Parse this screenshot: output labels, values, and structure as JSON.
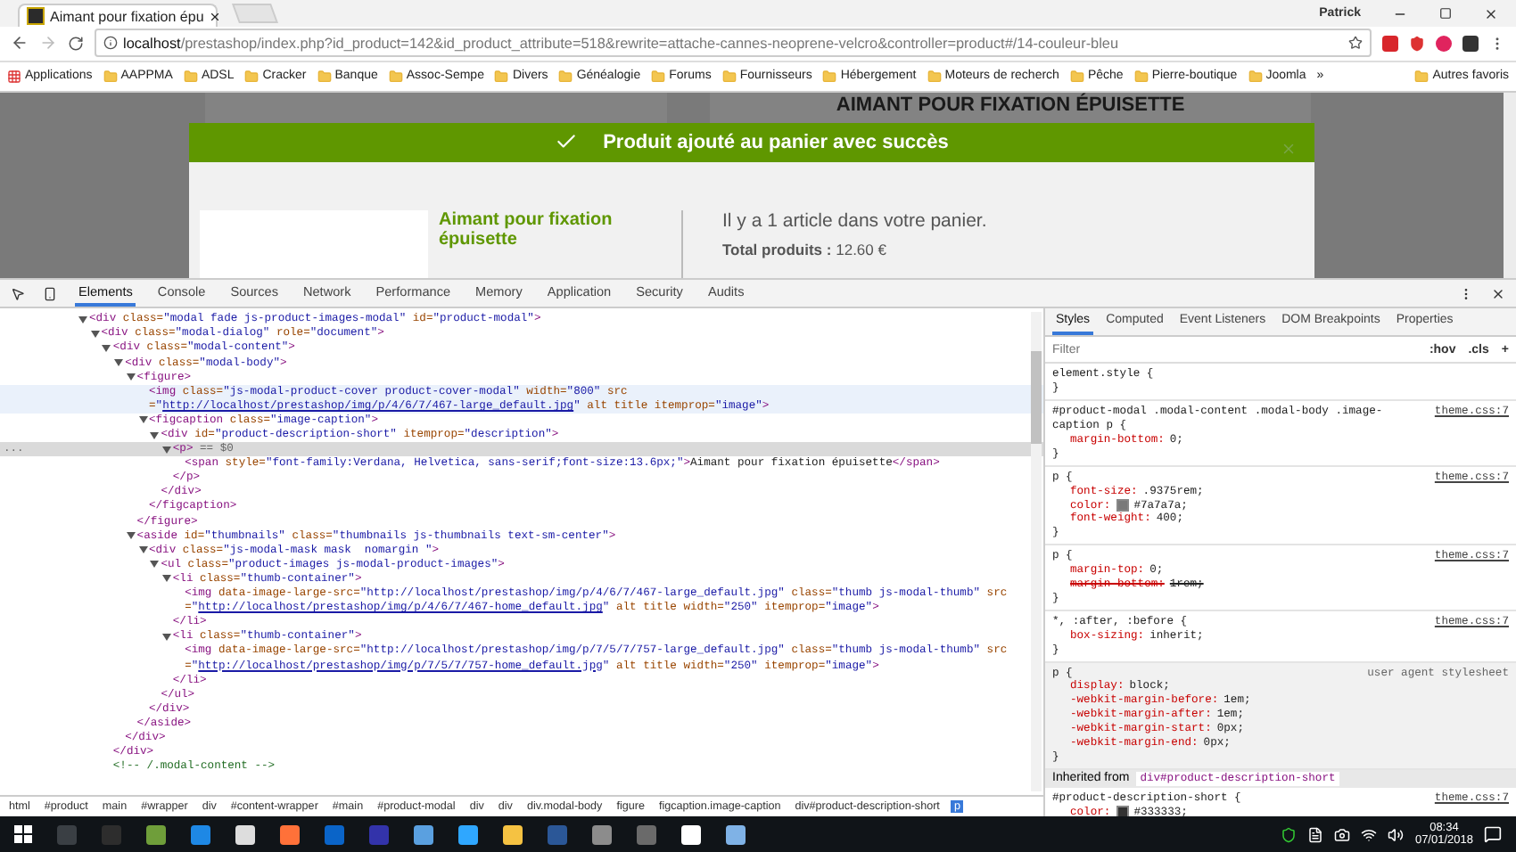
{
  "browser": {
    "tab_title": "Aimant pour fixation épu",
    "profile_name": "Patrick",
    "url_host": "localhost",
    "url_path": "/prestashop/index.php?id_product=142&id_product_attribute=518&rewrite=attache-cannes-neoprene-velcro&controller=product#/14-couleur-bleu",
    "bookmarks": [
      {
        "kind": "apps",
        "label": "Applications"
      },
      {
        "kind": "folder",
        "label": "AAPPMA"
      },
      {
        "kind": "folder",
        "label": "ADSL"
      },
      {
        "kind": "folder",
        "label": "Cracker"
      },
      {
        "kind": "folder",
        "label": "Banque"
      },
      {
        "kind": "folder",
        "label": "Assoc-Sempe"
      },
      {
        "kind": "folder",
        "label": "Divers"
      },
      {
        "kind": "folder",
        "label": "Généalogie"
      },
      {
        "kind": "folder",
        "label": "Forums"
      },
      {
        "kind": "folder",
        "label": "Fournisseurs"
      },
      {
        "kind": "folder",
        "label": "Hébergement"
      },
      {
        "kind": "folder",
        "label": "Moteurs de recherch"
      },
      {
        "kind": "folder",
        "label": "Pêche"
      },
      {
        "kind": "folder",
        "label": "Pierre-boutique"
      },
      {
        "kind": "folder",
        "label": "Joomla"
      },
      {
        "kind": "overflow",
        "label": "»"
      },
      {
        "kind": "folder",
        "label": "Autres favoris"
      }
    ]
  },
  "page": {
    "heading": "AIMANT POUR FIXATION ÉPUISETTE",
    "banner": "Produit ajouté au panier avec succès",
    "product_name": "Aimant pour fixation épuisette",
    "cart_message": "Il y a 1 article dans votre panier.",
    "total_label": "Total produits :",
    "total_value": "12.60 €"
  },
  "devtools": {
    "tabs": [
      {
        "label": "Elements",
        "selected": true
      },
      {
        "label": "Console",
        "selected": false
      },
      {
        "label": "Sources",
        "selected": false
      },
      {
        "label": "Network",
        "selected": false
      },
      {
        "label": "Performance",
        "selected": false
      },
      {
        "label": "Memory",
        "selected": false
      },
      {
        "label": "Application",
        "selected": false
      },
      {
        "label": "Security",
        "selected": false
      },
      {
        "label": "Audits",
        "selected": false
      }
    ],
    "dom_tree": [
      {
        "expanded": true,
        "selected": false,
        "hovered": false,
        "open": [
          {
            "kind": "tag",
            "text": "<div"
          },
          {
            "kind": "attr",
            "text": " class="
          },
          {
            "kind": "value",
            "text": "\"modal fade js-product-images-modal\""
          },
          {
            "kind": "attr",
            "text": " id="
          },
          {
            "kind": "value",
            "text": "\"product-modal\""
          },
          {
            "kind": "tag",
            "text": ">"
          }
        ],
        "children": [
          {
            "expanded": true,
            "selected": false,
            "hovered": false,
            "open": [
              {
                "kind": "tag",
                "text": "<div"
              },
              {
                "kind": "attr",
                "text": " class="
              },
              {
                "kind": "value",
                "text": "\"modal-dialog\""
              },
              {
                "kind": "attr",
                "text": " role="
              },
              {
                "kind": "value",
                "text": "\"document\""
              },
              {
                "kind": "tag",
                "text": ">"
              }
            ],
            "children": [
              {
                "expanded": true,
                "selected": false,
                "hovered": false,
                "open": [
                  {
                    "kind": "tag",
                    "text": "<div"
                  },
                  {
                    "kind": "attr",
                    "text": " class="
                  },
                  {
                    "kind": "value",
                    "text": "\"modal-content\""
                  },
                  {
                    "kind": "tag",
                    "text": ">"
                  }
                ],
                "children": [
                  {
                    "expanded": true,
                    "selected": false,
                    "hovered": false,
                    "open": [
                      {
                        "kind": "tag",
                        "text": "<div"
                      },
                      {
                        "kind": "attr",
                        "text": " class="
                      },
                      {
                        "kind": "value",
                        "text": "\"modal-body\""
                      },
                      {
                        "kind": "tag",
                        "text": ">"
                      }
                    ],
                    "children": [
                      {
                        "expanded": true,
                        "selected": false,
                        "hovered": false,
                        "open": [
                          {
                            "kind": "tag",
                            "text": "<figure>"
                          }
                        ],
                        "children": [
                          {
                            "selected": false,
                            "hovered": true,
                            "open": [
                              {
                                "kind": "tag",
                                "text": "<img"
                              },
                              {
                                "kind": "attr",
                                "text": " class="
                              },
                              {
                                "kind": "value",
                                "text": "\"js-modal-product-cover product-cover-modal\""
                              },
                              {
                                "kind": "attr",
                                "text": " width="
                              },
                              {
                                "kind": "value",
                                "text": "\"800\""
                              },
                              {
                                "kind": "attr",
                                "text": " src="
                              },
                              {
                                "kind": "value",
                                "text": "\""
                              },
                              {
                                "kind": "link",
                                "text": "http://localhost/prestashop/img/p/4/6/7/467-large_default.jpg"
                              },
                              {
                                "kind": "value",
                                "text": "\""
                              },
                              {
                                "kind": "attr",
                                "text": " alt title itemprop="
                              },
                              {
                                "kind": "value",
                                "text": "\"image\""
                              },
                              {
                                "kind": "tag",
                                "text": ">"
                              }
                            ]
                          },
                          {
                            "expanded": true,
                            "selected": false,
                            "hovered": false,
                            "open": [
                              {
                                "kind": "tag",
                                "text": "<figcaption"
                              },
                              {
                                "kind": "attr",
                                "text": " class="
                              },
                              {
                                "kind": "value",
                                "text": "\"image-caption\""
                              },
                              {
                                "kind": "tag",
                                "text": ">"
                              }
                            ],
                            "children": [
                              {
                                "expanded": true,
                                "selected": false,
                                "hovered": false,
                                "open": [
                                  {
                                    "kind": "tag",
                                    "text": "<div"
                                  },
                                  {
                                    "kind": "attr",
                                    "text": " id="
                                  },
                                  {
                                    "kind": "value",
                                    "text": "\"product-description-short\""
                                  },
                                  {
                                    "kind": "attr",
                                    "text": " itemprop="
                                  },
                                  {
                                    "kind": "value",
                                    "text": "\"description\""
                                  },
                                  {
                                    "kind": "tag",
                                    "text": ">"
                                  }
                                ],
                                "children": [
                                  {
                                    "expanded": true,
                                    "selected": true,
                                    "hovered": false,
                                    "gutter": "...",
                                    "open": [
                                      {
                                        "kind": "tag",
                                        "text": "<p>"
                                      },
                                      {
                                        "kind": "marker",
                                        "text": " == $0"
                                      }
                                    ],
                                    "children": [
                                      {
                                        "selected": false,
                                        "hovered": false,
                                        "open": [
                                          {
                                            "kind": "tag",
                                            "text": "<span"
                                          },
                                          {
                                            "kind": "attr",
                                            "text": " style="
                                          },
                                          {
                                            "kind": "value",
                                            "text": "\"font-family:Verdana, Helvetica, sans-serif;font-size:13.6px;\""
                                          },
                                          {
                                            "kind": "tag",
                                            "text": ">"
                                          },
                                          {
                                            "kind": "text",
                                            "text": "Aimant pour fixation épuisette"
                                          },
                                          {
                                            "kind": "tag",
                                            "text": "</span>"
                                          }
                                        ]
                                      }
                                    ],
                                    "close": [
                                      {
                                        "kind": "tag",
                                        "text": "</p>"
                                      }
                                    ]
                                  }
                                ],
                                "close": [
                                  {
                                    "kind": "tag",
                                    "text": "</div>"
                                  }
                                ]
                              }
                            ],
                            "close": [
                              {
                                "kind": "tag",
                                "text": "</figcaption>"
                              }
                            ]
                          }
                        ],
                        "close": [
                          {
                            "kind": "tag",
                            "text": "</figure>"
                          }
                        ]
                      },
                      {
                        "expanded": true,
                        "selected": false,
                        "hovered": false,
                        "open": [
                          {
                            "kind": "tag",
                            "text": "<aside"
                          },
                          {
                            "kind": "attr",
                            "text": " id="
                          },
                          {
                            "kind": "value",
                            "text": "\"thumbnails\""
                          },
                          {
                            "kind": "attr",
                            "text": " class="
                          },
                          {
                            "kind": "value",
                            "text": "\"thumbnails js-thumbnails text-sm-center\""
                          },
                          {
                            "kind": "tag",
                            "text": ">"
                          }
                        ],
                        "children": [
                          {
                            "expanded": true,
                            "selected": false,
                            "hovered": false,
                            "open": [
                              {
                                "kind": "tag",
                                "text": "<div"
                              },
                              {
                                "kind": "attr",
                                "text": " class="
                              },
                              {
                                "kind": "value",
                                "text": "\"js-modal-mask mask  nomargin \""
                              },
                              {
                                "kind": "tag",
                                "text": ">"
                              }
                            ],
                            "children": [
                              {
                                "expanded": true,
                                "selected": false,
                                "hovered": false,
                                "open": [
                                  {
                                    "kind": "tag",
                                    "text": "<ul"
                                  },
                                  {
                                    "kind": "attr",
                                    "text": " class="
                                  },
                                  {
                                    "kind": "value",
                                    "text": "\"product-images js-modal-product-images\""
                                  },
                                  {
                                    "kind": "tag",
                                    "text": ">"
                                  }
                                ],
                                "children": [
                                  {
                                    "expanded": true,
                                    "selected": false,
                                    "hovered": false,
                                    "open": [
                                      {
                                        "kind": "tag",
                                        "text": "<li"
                                      },
                                      {
                                        "kind": "attr",
                                        "text": " class="
                                      },
                                      {
                                        "kind": "value",
                                        "text": "\"thumb-container\""
                                      },
                                      {
                                        "kind": "tag",
                                        "text": ">"
                                      }
                                    ],
                                    "children": [
                                      {
                                        "selected": false,
                                        "hovered": false,
                                        "open": [
                                          {
                                            "kind": "tag",
                                            "text": "<img"
                                          },
                                          {
                                            "kind": "attr",
                                            "text": " data-image-large-src="
                                          },
                                          {
                                            "kind": "value",
                                            "text": "\"http://localhost/prestashop/img/p/4/6/7/467-large_default.jpg\""
                                          },
                                          {
                                            "kind": "attr",
                                            "text": " class="
                                          },
                                          {
                                            "kind": "value",
                                            "text": "\"thumb js-modal-thumb\""
                                          },
                                          {
                                            "kind": "attr",
                                            "text": " src="
                                          },
                                          {
                                            "kind": "value",
                                            "text": "\""
                                          },
                                          {
                                            "kind": "link",
                                            "text": "http://localhost/prestashop/img/p/4/6/7/467-home_default.jpg"
                                          },
                                          {
                                            "kind": "value",
                                            "text": "\""
                                          },
                                          {
                                            "kind": "attr",
                                            "text": " alt title width="
                                          },
                                          {
                                            "kind": "value",
                                            "text": "\"250\""
                                          },
                                          {
                                            "kind": "attr",
                                            "text": " itemprop="
                                          },
                                          {
                                            "kind": "value",
                                            "text": "\"image\""
                                          },
                                          {
                                            "kind": "tag",
                                            "text": ">"
                                          }
                                        ]
                                      }
                                    ],
                                    "close": [
                                      {
                                        "kind": "tag",
                                        "text": "</li>"
                                      }
                                    ]
                                  },
                                  {
                                    "expanded": true,
                                    "selected": false,
                                    "hovered": false,
                                    "open": [
                                      {
                                        "kind": "tag",
                                        "text": "<li"
                                      },
                                      {
                                        "kind": "attr",
                                        "text": " class="
                                      },
                                      {
                                        "kind": "value",
                                        "text": "\"thumb-container\""
                                      },
                                      {
                                        "kind": "tag",
                                        "text": ">"
                                      }
                                    ],
                                    "children": [
                                      {
                                        "selected": false,
                                        "hovered": false,
                                        "open": [
                                          {
                                            "kind": "tag",
                                            "text": "<img"
                                          },
                                          {
                                            "kind": "attr",
                                            "text": " data-image-large-src="
                                          },
                                          {
                                            "kind": "value",
                                            "text": "\"http://localhost/prestashop/img/p/7/5/7/757-large_default.jpg\""
                                          },
                                          {
                                            "kind": "attr",
                                            "text": " class="
                                          },
                                          {
                                            "kind": "value",
                                            "text": "\"thumb js-modal-thumb\""
                                          },
                                          {
                                            "kind": "attr",
                                            "text": " src="
                                          },
                                          {
                                            "kind": "value",
                                            "text": "\""
                                          },
                                          {
                                            "kind": "link",
                                            "text": "http://localhost/prestashop/img/p/7/5/7/757-home_default.jpg"
                                          },
                                          {
                                            "kind": "value",
                                            "text": "\""
                                          },
                                          {
                                            "kind": "attr",
                                            "text": " alt title width="
                                          },
                                          {
                                            "kind": "value",
                                            "text": "\"250\""
                                          },
                                          {
                                            "kind": "attr",
                                            "text": " itemprop="
                                          },
                                          {
                                            "kind": "value",
                                            "text": "\"image\""
                                          },
                                          {
                                            "kind": "tag",
                                            "text": ">"
                                          }
                                        ]
                                      }
                                    ],
                                    "close": [
                                      {
                                        "kind": "tag",
                                        "text": "</li>"
                                      }
                                    ]
                                  }
                                ],
                                "close": [
                                  {
                                    "kind": "tag",
                                    "text": "</ul>"
                                  }
                                ]
                              }
                            ],
                            "close": [
                              {
                                "kind": "tag",
                                "text": "</div>"
                              }
                            ]
                          }
                        ],
                        "close": [
                          {
                            "kind": "tag",
                            "text": "</aside>"
                          }
                        ]
                      }
                    ],
                    "close": [
                      {
                        "kind": "tag",
                        "text": "</div>"
                      }
                    ]
                  }
                ],
                "close": [
                  {
                    "kind": "tag",
                    "text": "</div>"
                  }
                ]
              },
              {
                "selected": false,
                "hovered": false,
                "open": [
                  {
                    "kind": "comment",
                    "text": "<!-- /.modal-content -->"
                  }
                ]
              }
            ]
          }
        ]
      }
    ],
    "breadcrumbs": [
      {
        "label": "html",
        "selected": false
      },
      {
        "label": "#product",
        "selected": false
      },
      {
        "label": "main",
        "selected": false
      },
      {
        "label": "#wrapper",
        "selected": false
      },
      {
        "label": "div",
        "selected": false
      },
      {
        "label": "#content-wrapper",
        "selected": false
      },
      {
        "label": "#main",
        "selected": false
      },
      {
        "label": "#product-modal",
        "selected": false
      },
      {
        "label": "div",
        "selected": false
      },
      {
        "label": "div",
        "selected": false
      },
      {
        "label": "div.modal-body",
        "selected": false
      },
      {
        "label": "figure",
        "selected": false
      },
      {
        "label": "figcaption.image-caption",
        "selected": false
      },
      {
        "label": "div#product-description-short",
        "selected": false
      },
      {
        "label": "p",
        "selected": true
      }
    ],
    "side_tabs": [
      {
        "label": "Styles",
        "selected": true
      },
      {
        "label": "Computed",
        "selected": false
      },
      {
        "label": "Event Listeners",
        "selected": false
      },
      {
        "label": "DOM Breakpoints",
        "selected": false
      },
      {
        "label": "Properties",
        "selected": false
      }
    ],
    "filter_placeholder": "Filter",
    "hov": ":hov",
    "cls": ".cls",
    "add": "+",
    "rules": [
      {
        "kind": "rule",
        "selector": "element.style {",
        "close": "}",
        "user_agent": false
      },
      {
        "kind": "rule",
        "selector": "#product-modal .modal-content .modal-body .image-caption p {",
        "source": "theme.css:7",
        "close": "}",
        "user_agent": false,
        "declarations": [
          {
            "property": "margin-bottom:",
            "value": "0;",
            "struck": false
          }
        ]
      },
      {
        "kind": "rule",
        "selector": "p {",
        "source": "theme.css:7",
        "close": "}",
        "user_agent": false,
        "declarations": [
          {
            "property": "font-size:",
            "value": ".9375rem;",
            "struck": false
          },
          {
            "property": "color:",
            "value": "#7a7a7a;",
            "color": "#7a7a7a",
            "struck": false
          },
          {
            "property": "font-weight:",
            "value": "400;",
            "struck": false
          }
        ]
      },
      {
        "kind": "rule",
        "selector": "p {",
        "source": "theme.css:7",
        "close": "}",
        "user_agent": false,
        "declarations": [
          {
            "property": "margin-top:",
            "value": "0;",
            "struck": false
          },
          {
            "property": "margin-bottom:",
            "value": "1rem;",
            "struck": true
          }
        ]
      },
      {
        "kind": "rule",
        "selector": "*, :after, :before {",
        "source": "theme.css:7",
        "close": "}",
        "user_agent": false,
        "declarations": [
          {
            "property": "box-sizing:",
            "value": "inherit;",
            "struck": false
          }
        ]
      },
      {
        "kind": "rule",
        "selector": "p {",
        "source": "user agent stylesheet",
        "close": "}",
        "user_agent": true,
        "declarations": [
          {
            "property": "display:",
            "value": "block;",
            "struck": false
          },
          {
            "property": "-webkit-margin-before:",
            "value": "1em;",
            "struck": false
          },
          {
            "property": "-webkit-margin-after:",
            "value": "1em;",
            "struck": false
          },
          {
            "property": "-webkit-margin-start:",
            "value": "0px;",
            "struck": false
          },
          {
            "property": "-webkit-margin-end:",
            "value": "0px;",
            "struck": false
          }
        ]
      },
      {
        "kind": "inherited",
        "label": "Inherited from",
        "selector": "div#product-description-short"
      },
      {
        "kind": "rule",
        "selector": "#product-description-short {",
        "source": "theme.css:7",
        "user_agent": false,
        "declarations": [
          {
            "property": "color:",
            "value": "#333333;",
            "color": "#333333",
            "struck": false
          }
        ]
      }
    ]
  },
  "taskbar": {
    "time": "08:34",
    "date": "07/01/2018"
  }
}
